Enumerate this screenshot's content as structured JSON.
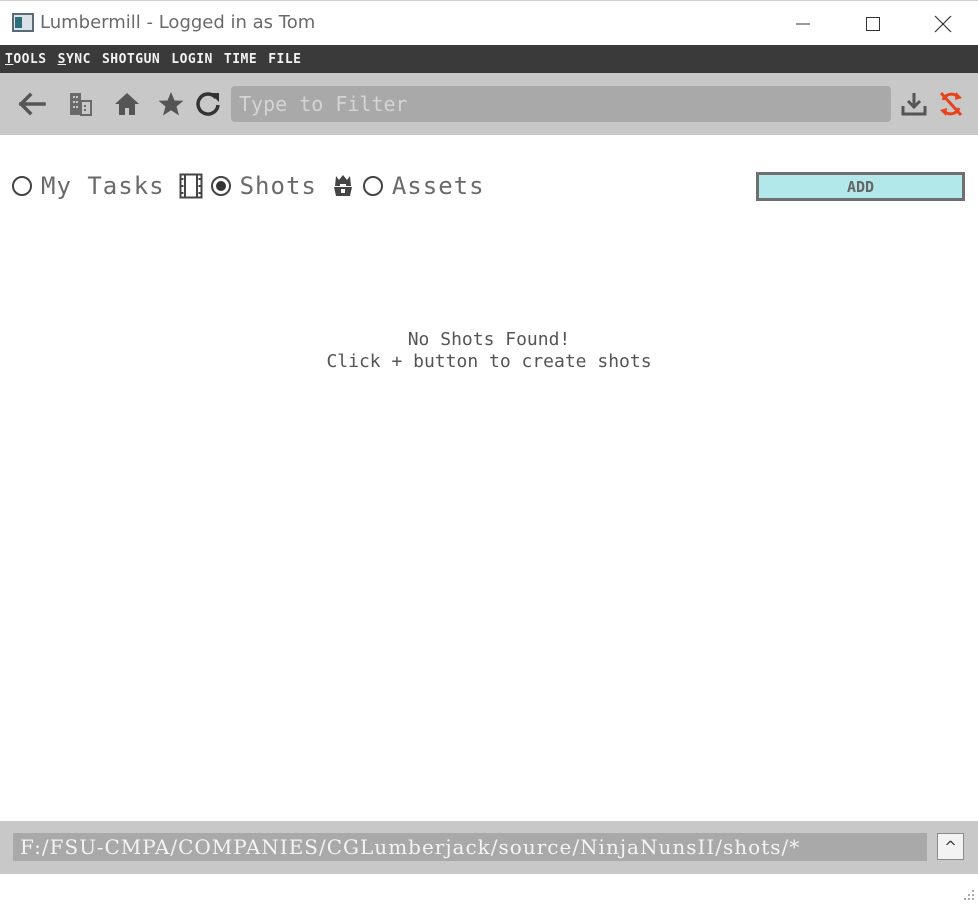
{
  "window": {
    "title": "Lumbermill - Logged in as Tom",
    "minimize": "—",
    "maximize": "☐",
    "close": "✕"
  },
  "menu": [
    {
      "label": "TOOLS",
      "accel": "T",
      "rest": "OOLS"
    },
    {
      "label": "SYNC",
      "accel": "S",
      "rest": "YNC"
    },
    {
      "label": "SHOTGUN"
    },
    {
      "label": "LOGIN"
    },
    {
      "label": "TIME"
    },
    {
      "label": "FILE"
    }
  ],
  "toolbar": {
    "icons": [
      "back-arrow-icon",
      "company-building-icon",
      "home-icon",
      "favorite-star-icon",
      "refresh-icon",
      "download-icon",
      "sync-disabled-icon"
    ],
    "filter_placeholder": "Type to Filter",
    "filter_value": ""
  },
  "modes": {
    "my_tasks_label": "My Tasks",
    "shots_label": "Shots",
    "assets_label": "Assets",
    "selected": "Shots"
  },
  "add_label": "ADD",
  "empty": {
    "line1": "No Shots Found!",
    "line2": "Click + button to create shots"
  },
  "footer": {
    "path": "F:/FSU-CMPA/COMPANIES/CGLumberjack/source/NinjaNunsII/shots/*",
    "up_label": "^"
  },
  "colors": {
    "menubar": "#3a3a3a",
    "toolbar": "#c8c8c8",
    "field": "#a9a9a9",
    "add_button": "#b3e8ea",
    "sync_alert": "#e8421d"
  }
}
